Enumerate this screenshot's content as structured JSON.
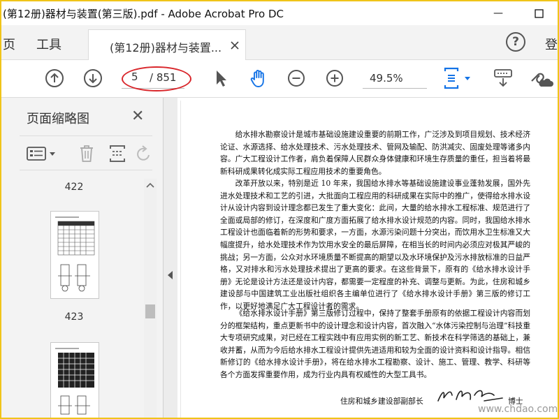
{
  "window": {
    "title": "(第12册)器材与装置(第三版).pdf - Adobe Acrobat Pro DC",
    "minimize_label": "—"
  },
  "tabbar": {
    "nav_home": "页",
    "nav_tools": "工具",
    "doc_tab_label": "(第12册)器材与装置...",
    "help_label": "?",
    "signin_label": "登"
  },
  "toolbar": {
    "current_page": "5",
    "total_pages": "/ 851",
    "zoom": "49.5%",
    "annotation_color": "#d9262b",
    "accent_color": "#1473e6"
  },
  "thumbnail_panel": {
    "title": "页面缩略图",
    "close_label": "✕",
    "pages": [
      {
        "number": "422"
      },
      {
        "number": "423"
      }
    ]
  },
  "document": {
    "paragraphs": [
      "给水排水勘察设计是城市基础设施建设重要的前期工作，广泛涉及到项目规划、技术经济论证、水源选择、给水处理技术、污水处理技术、管网及输配、防洪减灾、固废处理等诸多内容。广大工程设计工作者，肩负着保障人民群众身体健康和环境生存质量的重任，担当着将最新科研成果转化成实际工程应用技术的重要角色。",
      "改革开放以来，特别是近 10 年来，我国给水排水等基础设施建设事业蓬勃发展，国外先进水处理技术和工艺的引进，大批面向工程应用的科研成果在实际中的推广，使得给水排水设计从设计内容到设计理念都已发生了重大变化：此间，大量的给水排水工程标准、规范进行了全面或局部的修订，在深度和广度方面拓展了给水排水设计规范的内容。同时，我国给水排水工程设计也面临着新的形势和要求，一方面，水源污染问题十分突出，而饮用水卫生标准又大幅度提升，给水处理技术作为饮用水安全的最后屏障，在相当长的时间内必须应对极其严峻的挑战；另一方面，公众对水环境质量不断提高的期望以及水环境保护及污水排放标准的日益严格，又对排水和污水处理技术提出了更高的要求。在这些背景下，原有的《给水排水设计手册》无论是设计方法还是设计内容，都需要一定程度的补充、调整与更新。为此，住房和城乡建设部与中国建筑工业出版社组织各主编单位进行了《给水排水设计手册》第三版的修订工作，以更好地满足广大工程设计者的需求。",
      "《给水排水设计手册》第三版修订过程中，保持了整套手册原有的依据工程设计内容而划分的框架结构，重点更新书中的设计理念和设计内容，首次融入“水体污染控制与治理”科技重大专项研究成果，对已经在工程实践中有应用实例的新工艺、新技术在科学筛选的基础上，兼收并蓄，从而为今后给水排水工程设计提供先进适用和较为全面的设计资料和设计指导。相信新修订的《给水排水设计手册》，将在给水排水工程勘察、设计、施工、管理、教学、科研等各个方面发挥重要作用，成为行业内具有权威性的大型工具书。"
    ],
    "signature_label": "住房和城乡建设部副部长",
    "signature_title": "博士",
    "watermark": "www.chdao.com"
  }
}
